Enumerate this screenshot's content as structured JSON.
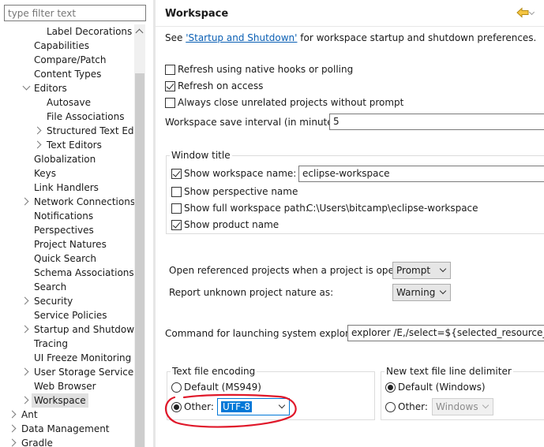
{
  "filter": {
    "placeholder": "type filter text"
  },
  "tree": {
    "items": [
      {
        "label": "Label Decorations"
      },
      {
        "label": "Capabilities"
      },
      {
        "label": "Compare/Patch"
      },
      {
        "label": "Content Types"
      },
      {
        "label": "Editors",
        "expanded": true
      },
      {
        "label": "Autosave"
      },
      {
        "label": "File Associations"
      },
      {
        "label": "Structured Text Editors"
      },
      {
        "label": "Text Editors"
      },
      {
        "label": "Globalization"
      },
      {
        "label": "Keys"
      },
      {
        "label": "Link Handlers"
      },
      {
        "label": "Network Connections"
      },
      {
        "label": "Notifications"
      },
      {
        "label": "Perspectives"
      },
      {
        "label": "Project Natures"
      },
      {
        "label": "Quick Search"
      },
      {
        "label": "Schema Associations"
      },
      {
        "label": "Search"
      },
      {
        "label": "Security"
      },
      {
        "label": "Service Policies"
      },
      {
        "label": "Startup and Shutdown"
      },
      {
        "label": "Tracing"
      },
      {
        "label": "UI Freeze Monitoring"
      },
      {
        "label": "User Storage Service"
      },
      {
        "label": "Web Browser"
      },
      {
        "label": "Workspace",
        "selected": true
      },
      {
        "label": "Ant"
      },
      {
        "label": "Data Management"
      },
      {
        "label": "Gradle"
      }
    ]
  },
  "page": {
    "title": "Workspace",
    "see_prefix": "See ",
    "see_link": "'Startup and Shutdown'",
    "see_suffix": " for workspace startup and shutdown preferences.",
    "refresh_native": {
      "label": "Refresh using native hooks or polling",
      "checked": false
    },
    "refresh_access": {
      "label": "Refresh on access",
      "checked": true
    },
    "close_unrelated": {
      "label": "Always close unrelated projects without prompt",
      "checked": false
    },
    "save_interval": {
      "label": "Workspace save interval (in minutes):",
      "value": "5"
    },
    "window_title": {
      "label": "Window title",
      "show_name": {
        "label": "Show workspace name:",
        "checked": true,
        "value": "eclipse-workspace"
      },
      "show_perspective": {
        "label": "Show perspective name",
        "checked": false
      },
      "show_path": {
        "label": "Show full workspace path:",
        "checked": false,
        "value": "C:\\Users\\bitcamp\\eclipse-workspace"
      },
      "show_product": {
        "label": "Show product name",
        "checked": true
      }
    },
    "open_referenced": {
      "label": "Open referenced projects when a project is opened:",
      "value": "Prompt"
    },
    "report_unknown": {
      "label": "Report unknown project nature as:",
      "value": "Warning"
    },
    "explorer_command": {
      "label": "Command for launching system explorer:",
      "value": "explorer /E,/select=${selected_resource_loc}"
    },
    "encoding": {
      "label": "Text file encoding",
      "default": {
        "label": "Default (MS949)",
        "checked": false
      },
      "other": {
        "label": "Other:",
        "checked": true,
        "value": "UTF-8"
      }
    },
    "line_delimiter": {
      "label": "New text file line delimiter",
      "default": {
        "label": "Default (Windows)",
        "checked": true
      },
      "other": {
        "label": "Other:",
        "checked": false,
        "value": "Windows"
      }
    },
    "annotation_color": "#e0182a"
  }
}
